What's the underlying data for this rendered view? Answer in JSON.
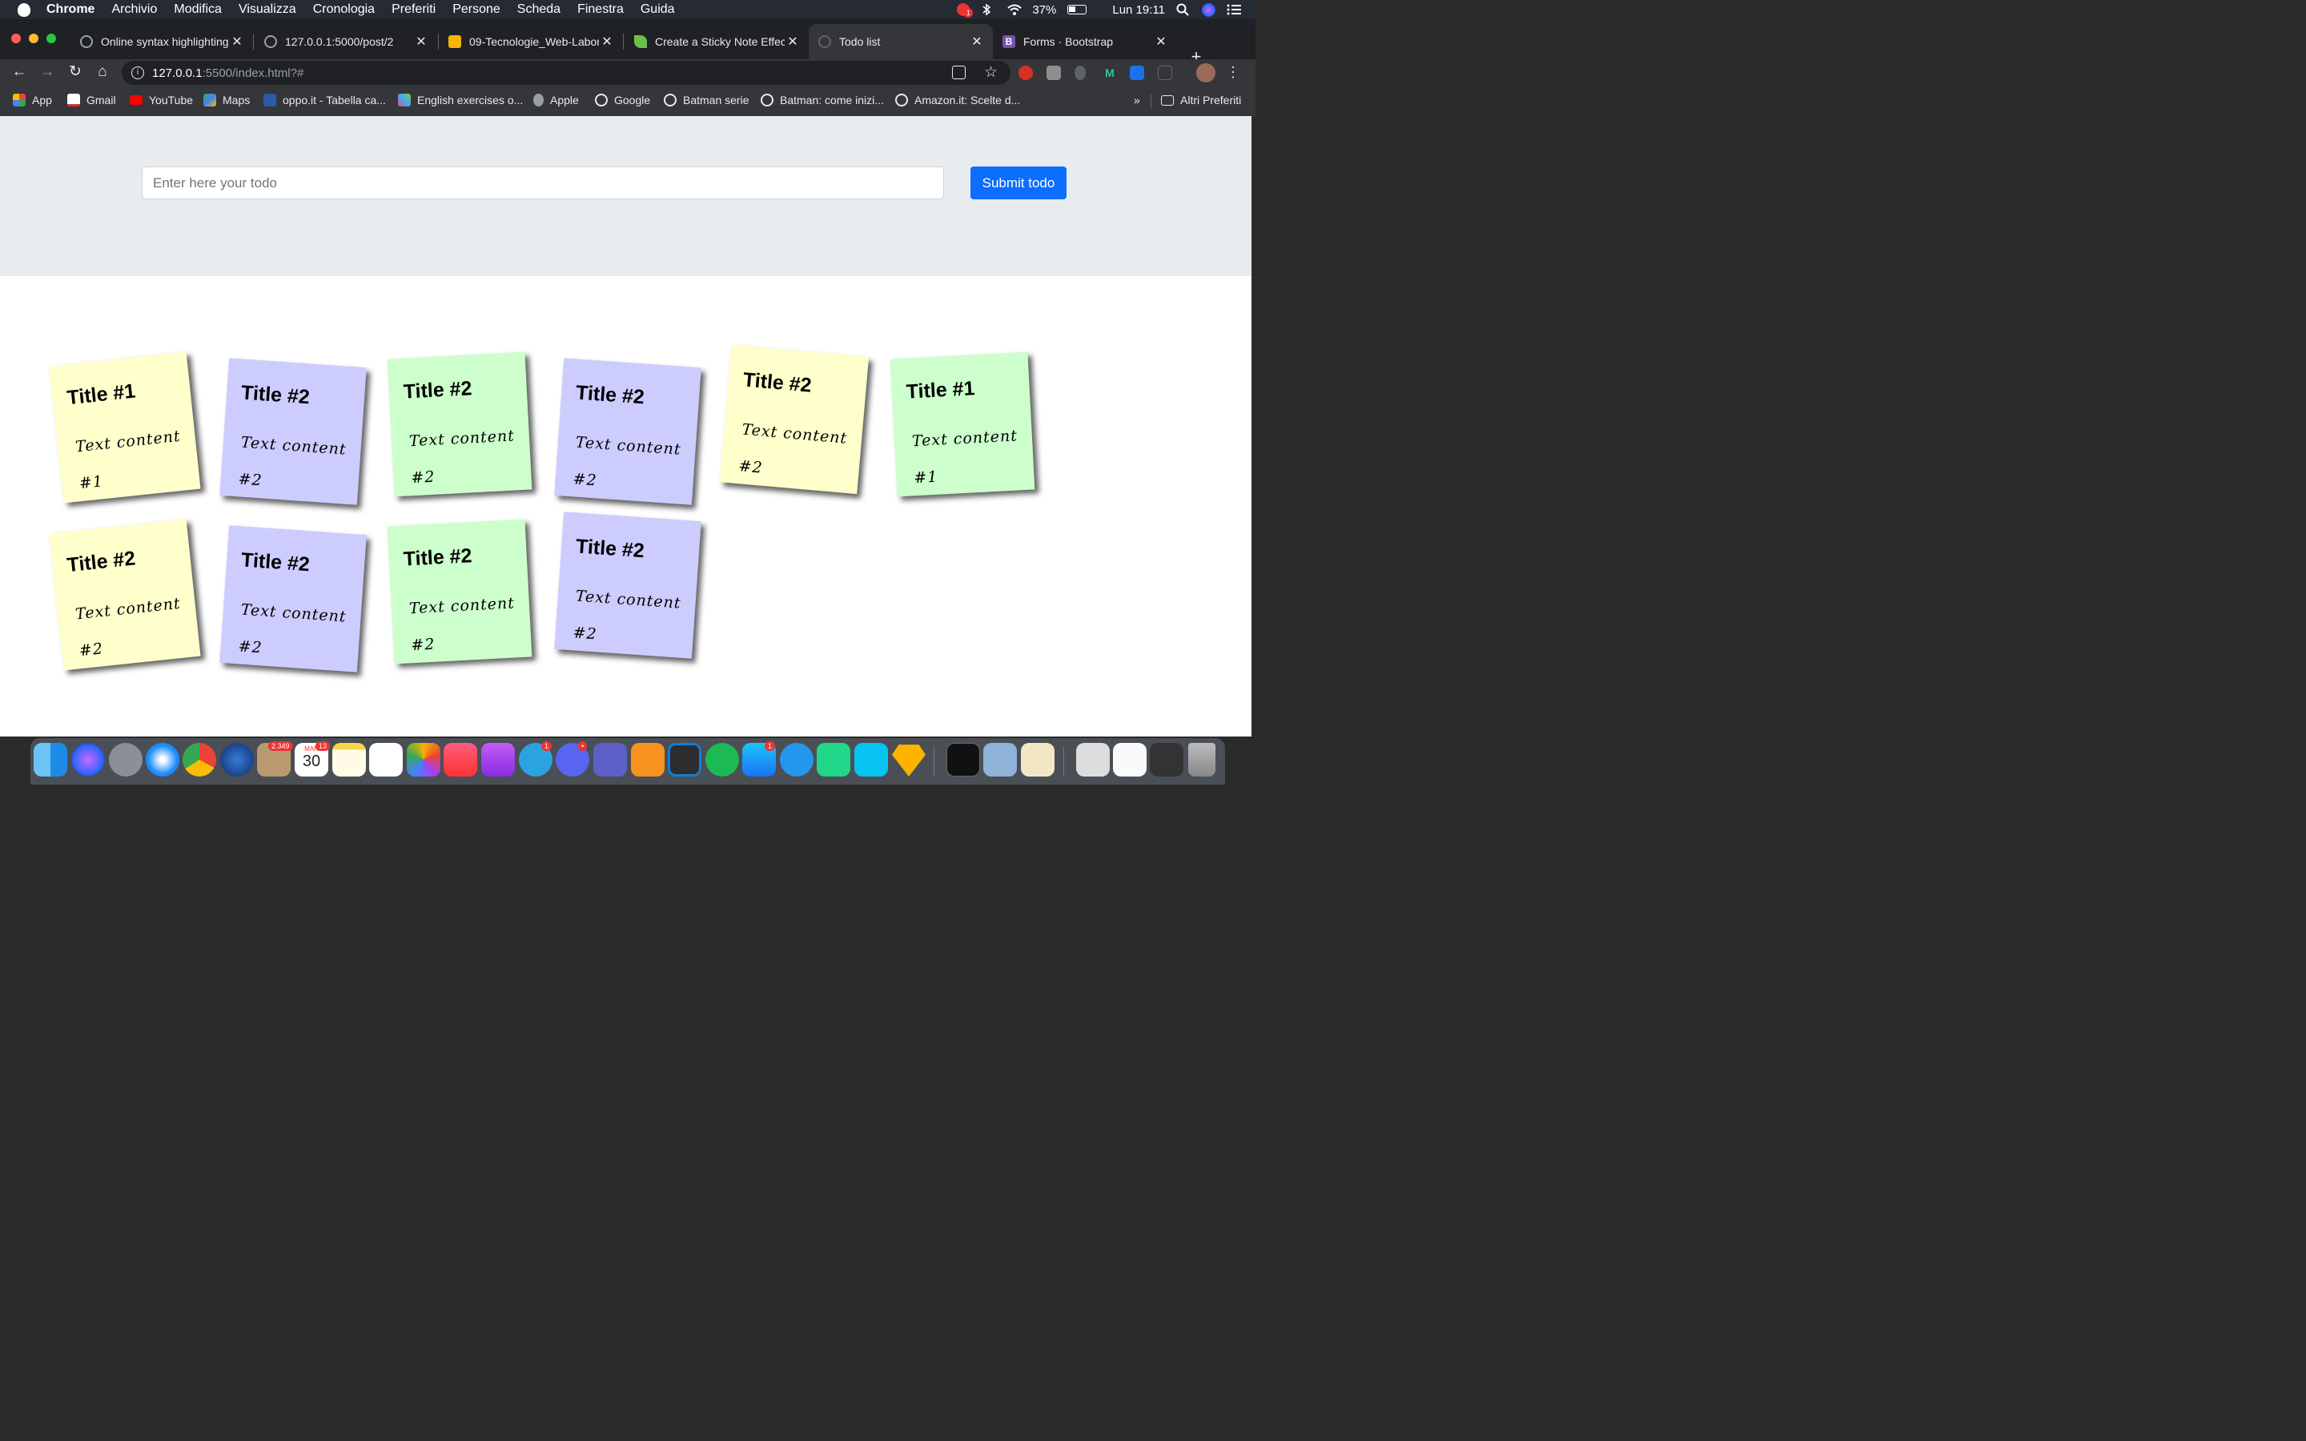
{
  "menubar": {
    "app_name": "Chrome",
    "items": [
      "Archivio",
      "Modifica",
      "Visualizza",
      "Cronologia",
      "Preferiti",
      "Persone",
      "Scheda",
      "Finestra",
      "Guida"
    ],
    "notification_badge": "1",
    "battery": "37%",
    "clock": "Lun 19:11"
  },
  "tabs": [
    {
      "label": "Online syntax highlighting f",
      "favicon": "globe-icon"
    },
    {
      "label": "127.0.0.1:5000/post/2",
      "favicon": "globe-icon"
    },
    {
      "label": "09-Tecnologie_Web-Labora",
      "favicon": "slides-icon"
    },
    {
      "label": "Create a Sticky Note Effect",
      "favicon": "leaf-icon"
    },
    {
      "label": "Todo list",
      "favicon": "globe-icon"
    },
    {
      "label": "Forms · Bootstrap",
      "favicon": "bootstrap-icon"
    }
  ],
  "active_tab_index": 4,
  "url": {
    "host": "127.0.0.1",
    "path": ":5500/index.html?#"
  },
  "bookmarks": [
    {
      "label": "App",
      "icon": "apps-grid-icon",
      "color": "#e8453c"
    },
    {
      "label": "Gmail",
      "icon": "gmail-icon",
      "color": "#d93025"
    },
    {
      "label": "YouTube",
      "icon": "youtube-icon",
      "color": "#ff0000"
    },
    {
      "label": "Maps",
      "icon": "maps-icon",
      "color": "#34a853"
    },
    {
      "label": "oppo.it - Tabella ca...",
      "icon": "chart-icon",
      "color": "#4285f4"
    },
    {
      "label": "English exercises o...",
      "icon": "figure-icon",
      "color": "#e94e77"
    },
    {
      "label": "Apple",
      "icon": "apple-icon",
      "color": "#9aa0a6"
    },
    {
      "label": "Google",
      "icon": "globe-icon",
      "color": "#e8eaed"
    },
    {
      "label": "Batman serie",
      "icon": "globe-icon",
      "color": "#e8eaed"
    },
    {
      "label": "Batman: come inizi...",
      "icon": "globe-icon",
      "color": "#e8eaed"
    },
    {
      "label": "Amazon.it: Scelte d...",
      "icon": "globe-icon",
      "color": "#e8eaed"
    }
  ],
  "bookmarks_overflow": "»",
  "other_bookmarks": "Altri Preferiti",
  "form": {
    "placeholder": "Enter here your todo",
    "submit_label": "Submit todo"
  },
  "notes": [
    {
      "title": "Title #1",
      "text": "Text content #1",
      "color": "yellow",
      "rotation_deg": -6
    },
    {
      "title": "Title #2",
      "text": "Text content #2",
      "color": "blue",
      "rotation_deg": 4
    },
    {
      "title": "Title #2",
      "text": "Text content #2",
      "color": "green",
      "rotation_deg": -3
    },
    {
      "title": "Title #2",
      "text": "Text content #2",
      "color": "blue",
      "rotation_deg": 4
    },
    {
      "title": "Title #2",
      "text": "Text content #2",
      "color": "yellow",
      "rotation_deg": 5
    },
    {
      "title": "Title #1",
      "text": "Text content #1",
      "color": "green",
      "rotation_deg": -3
    },
    {
      "title": "Title #2",
      "text": "Text content #2",
      "color": "yellow",
      "rotation_deg": -6
    },
    {
      "title": "Title #2",
      "text": "Text content #2",
      "color": "blue",
      "rotation_deg": 4
    },
    {
      "title": "Title #2",
      "text": "Text content #2",
      "color": "green",
      "rotation_deg": -3
    },
    {
      "title": "Title #2",
      "text": "Text content #2",
      "color": "blue",
      "rotation_deg": 4
    }
  ],
  "dock": {
    "apps": [
      "Finder",
      "Siri",
      "Launchpad",
      "Safari",
      "Chrome",
      "Firefox",
      "Mail",
      "Calendar",
      "Notes",
      "Reminders",
      "Photos",
      "Music",
      "Podcasts",
      "Telegram",
      "Discord",
      "Teams",
      "Books",
      "VS Code",
      "Spotify",
      "App Store",
      "Docker",
      "PyCharm",
      "WebStorm",
      "Sketch",
      "Terminal",
      "Preview",
      "TextEdit"
    ],
    "mail_badge": "2.349",
    "calendar_month": "MAR",
    "calendar_day": "30",
    "calendar_badge": "13",
    "telegram_badge": "1",
    "discord_badge": "•",
    "appstore_badge": "1"
  }
}
